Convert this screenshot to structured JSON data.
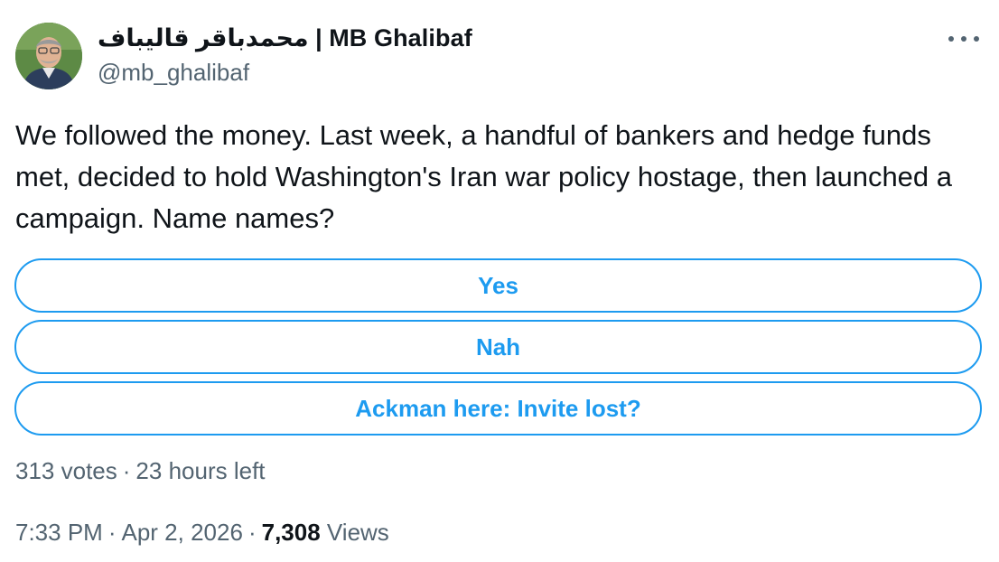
{
  "author": {
    "display_name": "محمدباقر قالیباف | MB Ghalibaf",
    "handle": "@mb_ghalibaf",
    "avatar_icon": "profile-photo"
  },
  "tweet": {
    "text": "We followed the money. Last week, a handful of bankers and hedge funds met, decided to hold Washington's Iran war policy hostage, then launched a campaign. Name names?"
  },
  "poll": {
    "options": [
      {
        "label": "Yes"
      },
      {
        "label": "Nah"
      },
      {
        "label": "Ackman here: Invite lost?"
      }
    ],
    "votes": "313 votes",
    "separator": "·",
    "time_left": "23 hours left"
  },
  "meta": {
    "time": "7:33 PM",
    "date": "Apr 2, 2026",
    "separator": "·",
    "views_count": "7,308",
    "views_label": "Views"
  },
  "colors": {
    "accent": "#1d9bf0",
    "secondary_text": "#536471",
    "primary_text": "#0f1419"
  }
}
